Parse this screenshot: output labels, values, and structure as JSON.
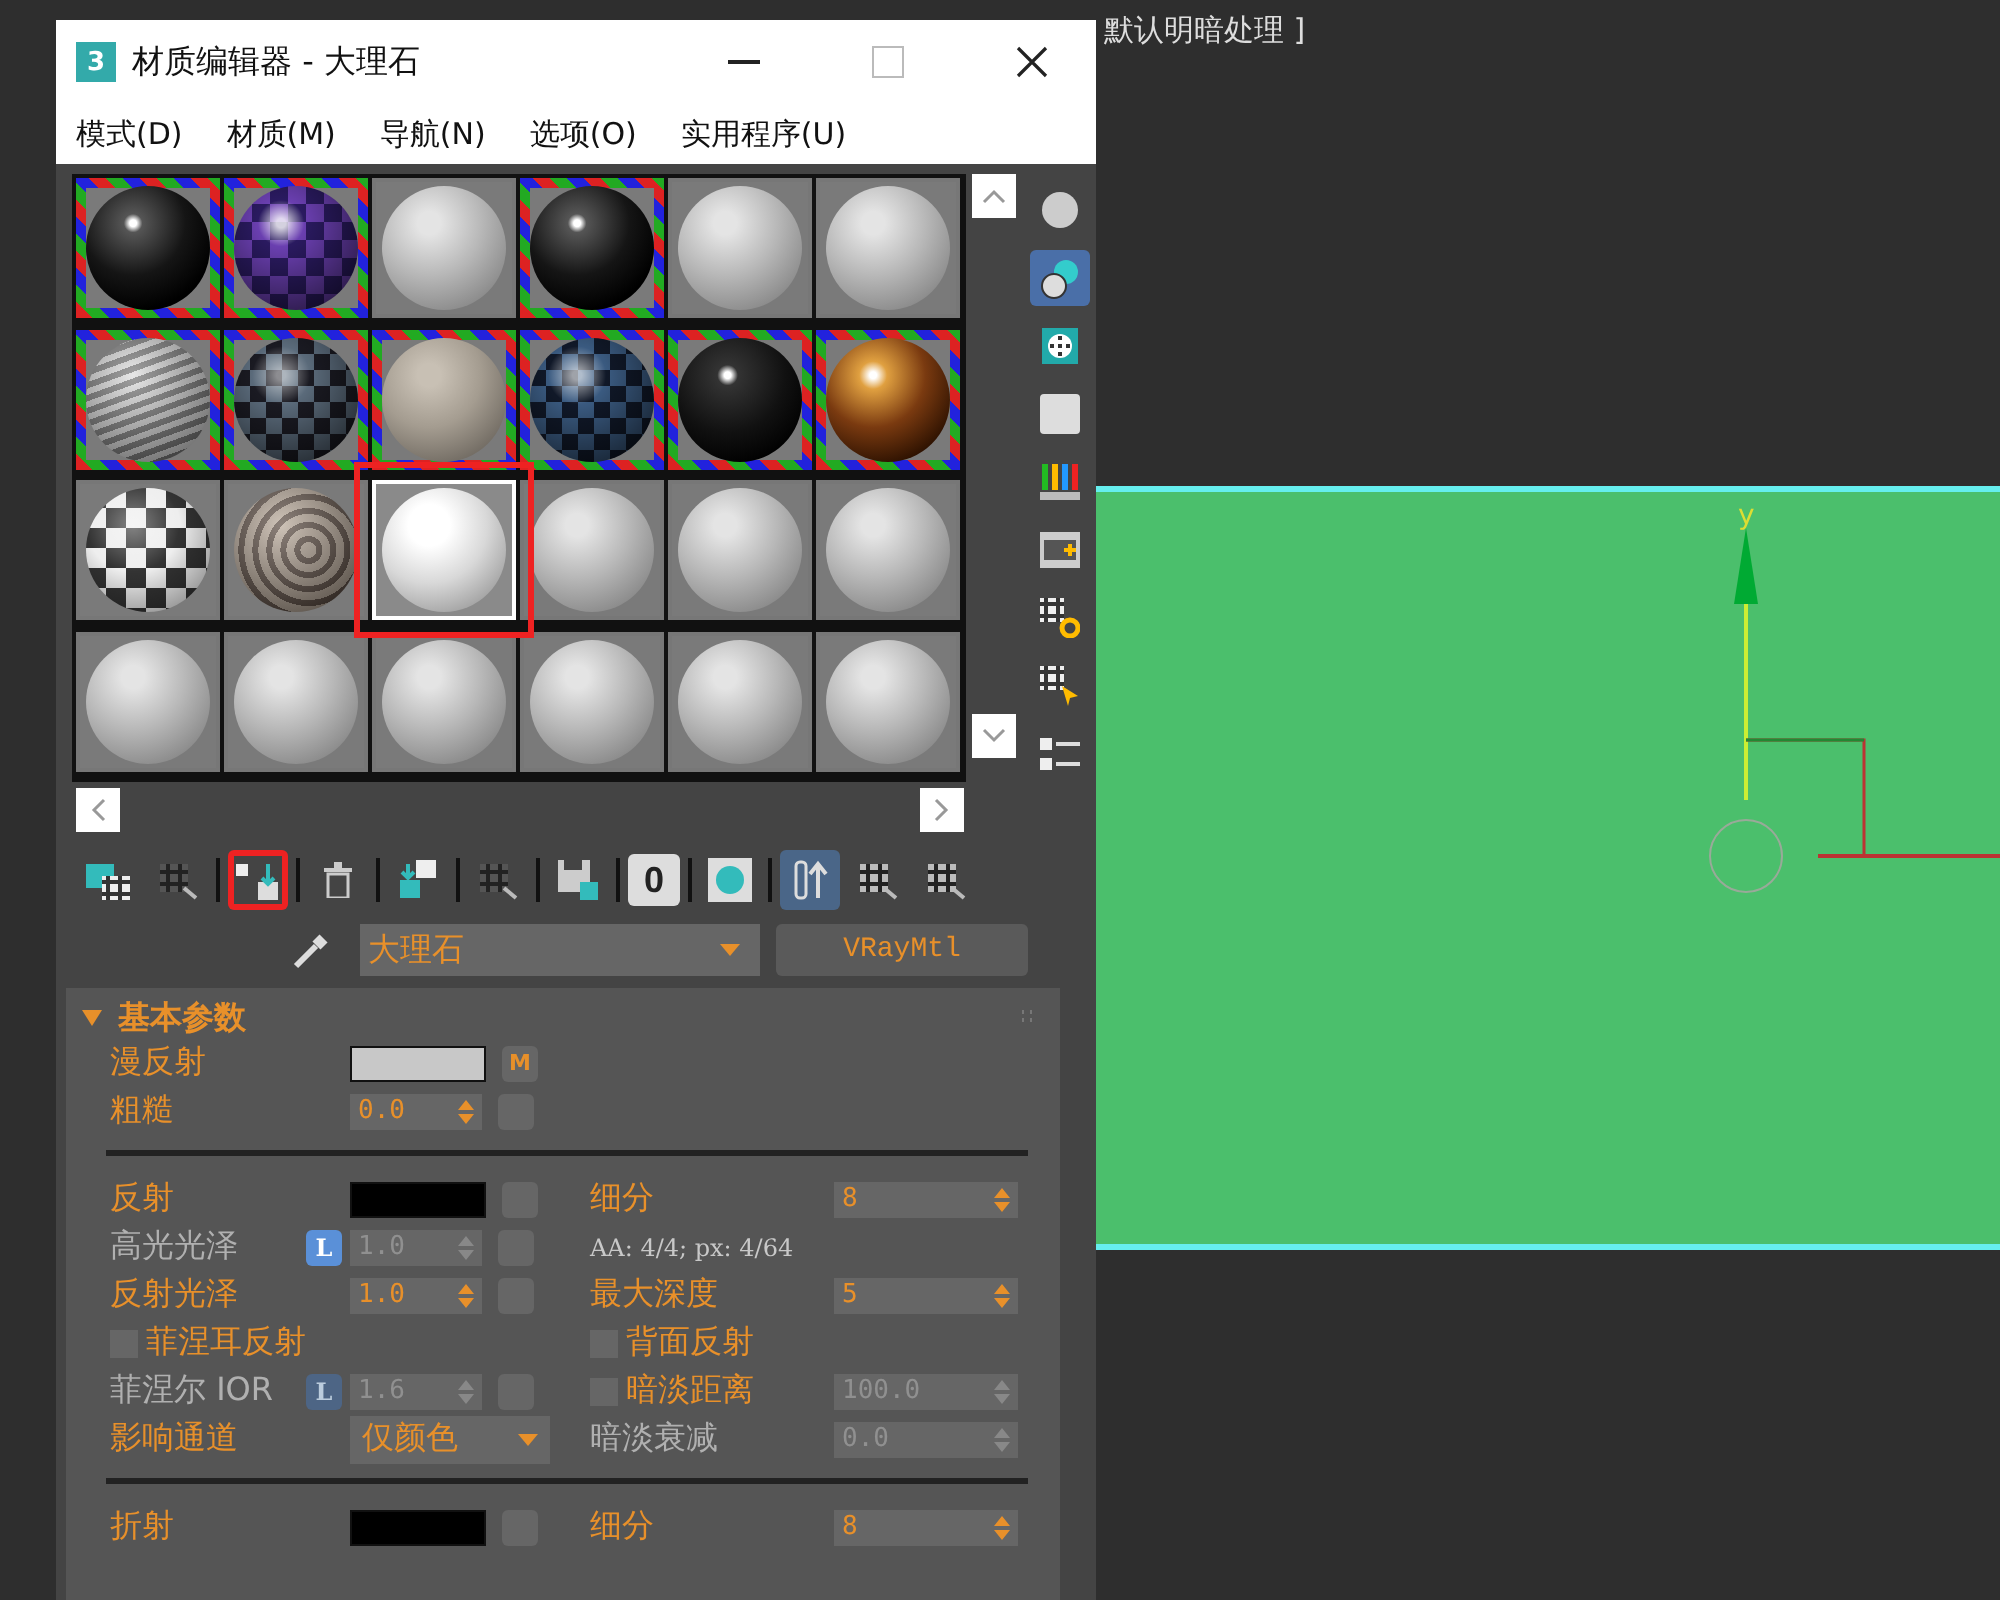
{
  "viewport": {
    "label": "默认明暗处理 ]",
    "axis_label": "y"
  },
  "window": {
    "app_icon": "3",
    "title": "材质编辑器 - 大理石",
    "maximize_disabled": true
  },
  "menu": [
    "模式(D)",
    "材质(M)",
    "导航(N)",
    "选项(O)",
    "实用程序(U)"
  ],
  "slots": [
    {
      "kind": "dark",
      "in_scene": true,
      "selected": false,
      "highlighted": false
    },
    {
      "kind": "purple-checker",
      "in_scene": true,
      "selected": false,
      "highlighted": false
    },
    {
      "kind": "gray",
      "in_scene": false,
      "selected": false,
      "highlighted": false
    },
    {
      "kind": "dark",
      "in_scene": true,
      "selected": false,
      "highlighted": false
    },
    {
      "kind": "gray",
      "in_scene": false,
      "selected": false,
      "highlighted": false
    },
    {
      "kind": "gray",
      "in_scene": false,
      "selected": false,
      "highlighted": false
    },
    {
      "kind": "stripes",
      "in_scene": true,
      "selected": false,
      "highlighted": false
    },
    {
      "kind": "dark-checker",
      "in_scene": true,
      "selected": false,
      "highlighted": false
    },
    {
      "kind": "beige",
      "in_scene": true,
      "selected": false,
      "highlighted": false
    },
    {
      "kind": "blue-checker",
      "in_scene": true,
      "selected": false,
      "highlighted": false
    },
    {
      "kind": "speckle",
      "in_scene": true,
      "selected": false,
      "highlighted": false
    },
    {
      "kind": "amber",
      "in_scene": true,
      "selected": false,
      "highlighted": false
    },
    {
      "kind": "checker",
      "in_scene": false,
      "selected": false,
      "highlighted": false
    },
    {
      "kind": "marble",
      "in_scene": false,
      "selected": false,
      "highlighted": false
    },
    {
      "kind": "white",
      "in_scene": false,
      "selected": true,
      "highlighted": true
    },
    {
      "kind": "gray",
      "in_scene": false,
      "selected": false,
      "highlighted": false
    },
    {
      "kind": "gray",
      "in_scene": false,
      "selected": false,
      "highlighted": false
    },
    {
      "kind": "gray",
      "in_scene": false,
      "selected": false,
      "highlighted": false
    },
    {
      "kind": "gray",
      "in_scene": false,
      "selected": false,
      "highlighted": false
    },
    {
      "kind": "gray",
      "in_scene": false,
      "selected": false,
      "highlighted": false
    },
    {
      "kind": "gray",
      "in_scene": false,
      "selected": false,
      "highlighted": false
    },
    {
      "kind": "gray",
      "in_scene": false,
      "selected": false,
      "highlighted": false
    },
    {
      "kind": "gray",
      "in_scene": false,
      "selected": false,
      "highlighted": false
    },
    {
      "kind": "gray",
      "in_scene": false,
      "selected": false,
      "highlighted": false
    }
  ],
  "side_toolbar": [
    {
      "kind": "sphere",
      "active": false
    },
    {
      "kind": "backlight",
      "active": true
    },
    {
      "kind": "background",
      "active": false
    },
    {
      "kind": "square",
      "active": false
    },
    {
      "kind": "color-bars",
      "active": false
    },
    {
      "kind": "film",
      "active": false
    },
    {
      "kind": "checker-gear",
      "active": false
    },
    {
      "kind": "checker-cursor",
      "active": false
    },
    {
      "kind": "list",
      "active": false
    }
  ],
  "toolbar": [
    {
      "kind": "folder-checker",
      "active": false,
      "highlighted": false
    },
    {
      "kind": "checker-pick",
      "active": false,
      "highlighted": false
    },
    {
      "kind": "separator"
    },
    {
      "kind": "put-to-scene",
      "active": false,
      "highlighted": true
    },
    {
      "kind": "separator"
    },
    {
      "kind": "trash",
      "active": false,
      "highlighted": false
    },
    {
      "kind": "separator"
    },
    {
      "kind": "copy",
      "active": false,
      "highlighted": false
    },
    {
      "kind": "separator"
    },
    {
      "kind": "checker-group",
      "active": false,
      "highlighted": false
    },
    {
      "kind": "separator"
    },
    {
      "kind": "save",
      "active": false,
      "highlighted": false
    },
    {
      "kind": "separator"
    },
    {
      "kind": "text",
      "label": "0",
      "active": false,
      "highlighted": false
    },
    {
      "kind": "separator"
    },
    {
      "kind": "show-map",
      "active": false,
      "highlighted": false
    },
    {
      "kind": "separator"
    },
    {
      "kind": "tube",
      "active": true,
      "highlighted": false
    },
    {
      "kind": "checker-back",
      "active": false,
      "highlighted": false
    },
    {
      "kind": "checker-forward",
      "active": false,
      "highlighted": false
    }
  ],
  "material": {
    "name": "大理石",
    "type": "VRayMtl"
  },
  "rollout": {
    "title": "基本参数",
    "expanded": true,
    "groups": [
      [
        {
          "left": {
            "kind": "color",
            "label": "漫反射",
            "color": "#c8c8c8",
            "map_button": true,
            "map_label": "M"
          }
        },
        {
          "left": {
            "kind": "spinner",
            "label": "粗糙",
            "value": "0.0",
            "disabled": false,
            "value_disabled": false,
            "map_button": true
          }
        }
      ],
      [
        {
          "left": {
            "kind": "color",
            "label": "反射",
            "color": "#000000",
            "map_button": true
          },
          "right": {
            "kind": "spinner",
            "label": "细分",
            "value": "8",
            "disabled": false,
            "value_disabled": false
          }
        },
        {
          "left": {
            "kind": "spinner",
            "label": "高光光泽",
            "disabled": true,
            "lock": {
              "label": "L",
              "active": true
            },
            "value": "1.0",
            "value_disabled": true,
            "map_button": true
          },
          "right": {
            "kind": "note",
            "text": "AA: 4/4; px: 4/64"
          }
        },
        {
          "left": {
            "kind": "spinner",
            "label": "反射光泽",
            "value": "1.0",
            "disabled": false,
            "value_disabled": false,
            "map_button": true
          },
          "right": {
            "kind": "spinner",
            "label": "最大深度",
            "value": "5",
            "disabled": false,
            "value_disabled": false
          }
        },
        {
          "left": {
            "kind": "checkbox",
            "label": "菲涅耳反射",
            "checked": false
          },
          "right": {
            "kind": "checkbox",
            "label": "背面反射",
            "checked": false
          }
        },
        {
          "left": {
            "kind": "spinner",
            "label": "菲涅尔 IOR",
            "disabled": true,
            "lock": {
              "label": "L",
              "active": false
            },
            "value": "1.6",
            "value_disabled": true,
            "map_button": true
          },
          "right": {
            "kind": "checkbox",
            "label": "暗淡距离",
            "checked": false,
            "value": "100.0",
            "value_disabled": true
          }
        },
        {
          "left": {
            "kind": "dropdown",
            "label": "影响通道",
            "value": "仅颜色"
          },
          "right": {
            "kind": "spinner",
            "label": "暗淡衰减",
            "disabled": true,
            "value": "0.0",
            "value_disabled": true
          }
        }
      ],
      [
        {
          "left": {
            "kind": "color",
            "label": "折射",
            "color": "#000000",
            "map_button": true
          },
          "right": {
            "kind": "spinner",
            "label": "细分",
            "value": "8",
            "disabled": false,
            "value_disabled": false
          }
        }
      ]
    ]
  }
}
